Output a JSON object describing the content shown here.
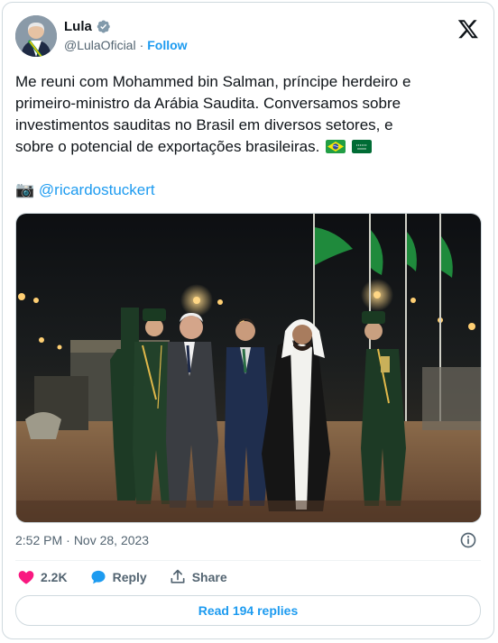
{
  "author": {
    "name": "Lula",
    "handle": "@LulaOficial",
    "follow_label": "Follow"
  },
  "tweet": {
    "text_line1": "Me reuni com Mohammed bin Salman, príncipe herdeiro e",
    "text_line2": "primeiro-ministro da Arábia Saudita. Conversamos sobre",
    "text_line3": "investimentos sauditas no Brasil em diversos setores, e",
    "text_line4": "sobre o potencial de exportações brasileiras.",
    "camera_emoji": "📷",
    "mention": "@ricardostuckert",
    "flags": [
      "brazil-flag-icon",
      "saudi-arabia-flag-icon"
    ]
  },
  "meta": {
    "time": "2:52 PM",
    "separator": "·",
    "date": "Nov 28, 2023"
  },
  "actions": {
    "likes": "2.2K",
    "reply_label": "Reply",
    "share_label": "Share"
  },
  "read_replies": "Read 194 replies",
  "colors": {
    "accent": "#1d9bf0",
    "like": "#f91880",
    "text": "#0f1419",
    "muted": "#536471",
    "border": "#cfd9de"
  }
}
